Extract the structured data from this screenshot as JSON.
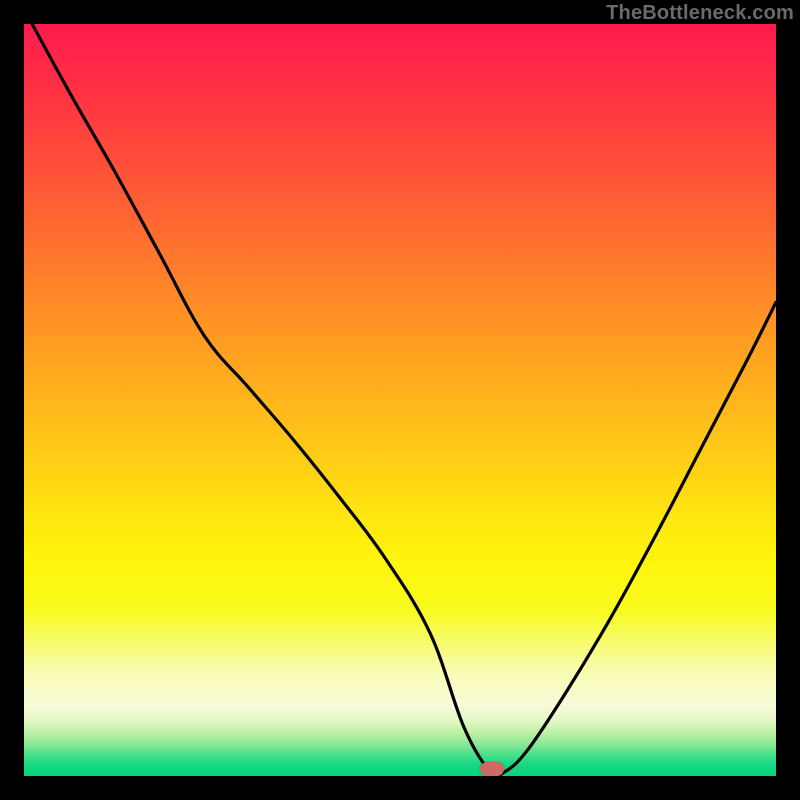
{
  "watermark": "TheBottleneck.com",
  "marker": {
    "x_pct": 62.2,
    "y_pct": 99.1
  },
  "chart_data": {
    "type": "line",
    "title": "",
    "xlabel": "",
    "ylabel": "",
    "xlim": [
      0,
      100
    ],
    "ylim": [
      0,
      100
    ],
    "series": [
      {
        "name": "bottleneck-curve",
        "x": [
          0,
          6,
          12,
          18,
          24,
          30,
          36,
          42,
          48,
          54,
          58.5,
          62,
          64,
          67,
          72,
          78,
          84,
          90,
          96,
          100
        ],
        "values": [
          102,
          91,
          80.5,
          69.5,
          58.5,
          51.5,
          44.5,
          37,
          29,
          19,
          6.5,
          0.6,
          0.6,
          3.5,
          11,
          21,
          32,
          43.5,
          55,
          63
        ]
      }
    ],
    "gradient_stops": [
      {
        "pct": 0,
        "color": "#ff1a4d"
      },
      {
        "pct": 36,
        "color": "#ff8828"
      },
      {
        "pct": 72,
        "color": "#fff60c"
      },
      {
        "pct": 90,
        "color": "#f8fbd8"
      },
      {
        "pct": 100,
        "color": "#06d480"
      }
    ]
  }
}
